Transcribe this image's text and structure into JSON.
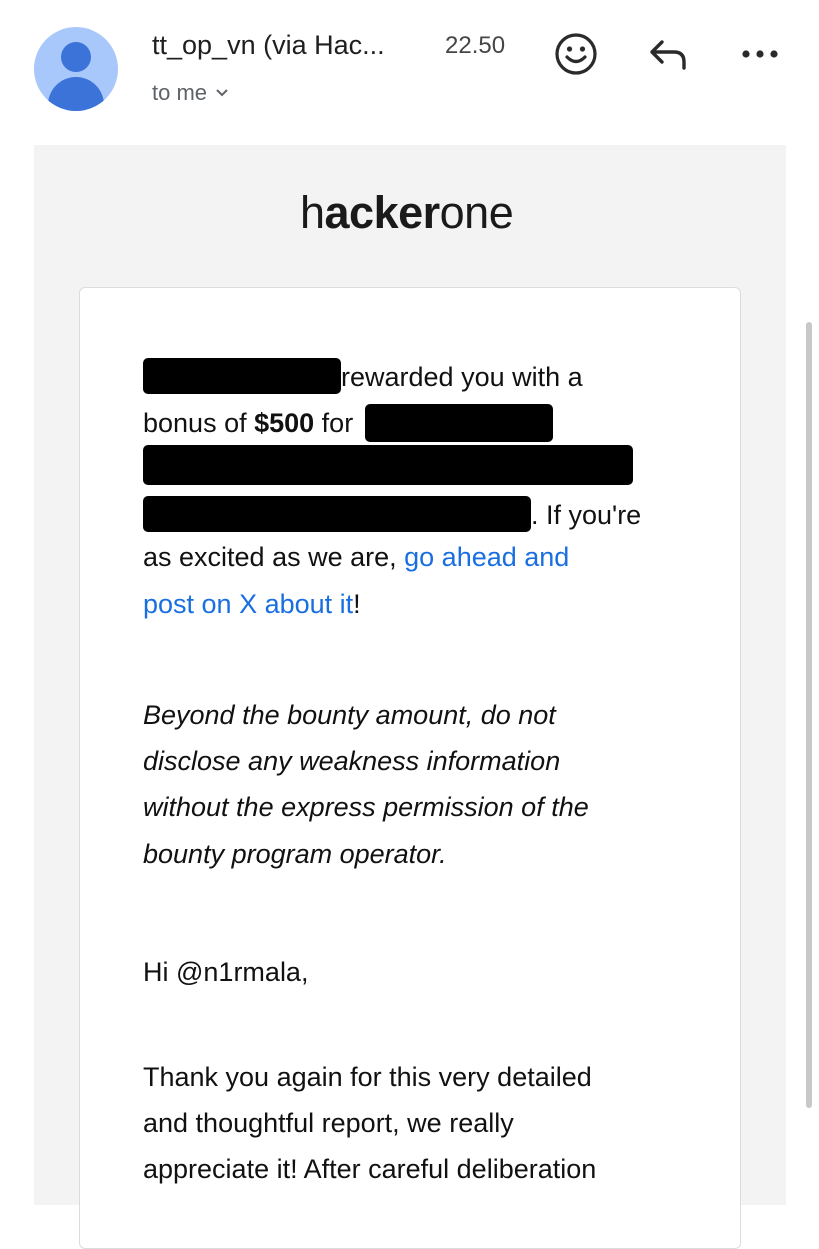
{
  "header": {
    "sender": "tt_op_vn (via Hac...",
    "time": "22.50",
    "recipient": "to me",
    "icons": {
      "avatar": "person-icon",
      "emoji": "smiley-icon",
      "reply": "reply-icon",
      "more": "more-dots-icon",
      "chevron": "chevron-down-icon"
    }
  },
  "email": {
    "logo_light": "h",
    "logo_main": "acker",
    "logo_end": "one",
    "p1": {
      "rewarded": "rewarded you with a",
      "bonus_prefix": "bonus of ",
      "amount": "$500",
      "for": " for",
      "if_youre": ". If you're",
      "excited": "as excited as we are, ",
      "link_part1": "go ahead and",
      "link_part2": "post on X about it",
      "exclaim": "!"
    },
    "p2": [
      "Beyond the bounty amount, do not",
      "disclose any weakness information",
      "without the express permission of the",
      "bounty program operator."
    ],
    "greeting": "Hi @n1rmala,",
    "p3": [
      "Thank you again for this very detailed",
      "and thoughtful report, we really",
      "appreciate it! After careful deliberation"
    ]
  },
  "colors": {
    "link": "#1a6fe0",
    "avatar_bg": "#a8c7fa",
    "avatar_fg": "#3b73d9",
    "email_bg": "#f3f3f3"
  }
}
